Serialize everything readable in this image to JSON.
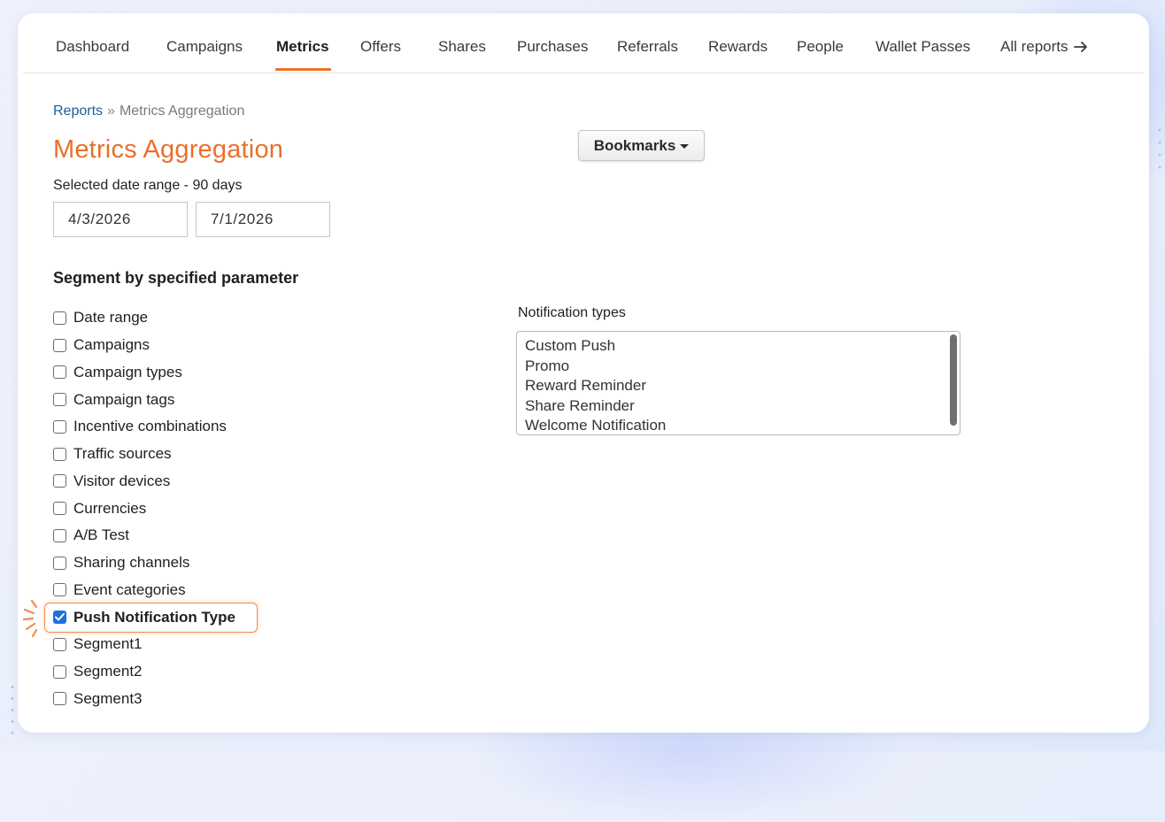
{
  "nav": {
    "items": [
      {
        "label": "Dashboard",
        "active": false
      },
      {
        "label": "Campaigns",
        "active": false
      },
      {
        "label": "Metrics",
        "active": true
      },
      {
        "label": "Offers",
        "active": false
      },
      {
        "label": "Shares",
        "active": false
      },
      {
        "label": "Purchases",
        "active": false
      },
      {
        "label": "Referrals",
        "active": false
      },
      {
        "label": "Rewards",
        "active": false
      },
      {
        "label": "People",
        "active": false
      },
      {
        "label": "Wallet Passes",
        "active": false
      },
      {
        "label": "All reports",
        "active": false,
        "icon": "arrow-right-icon"
      }
    ],
    "accent_color": "#e8702a"
  },
  "breadcrumb": {
    "parent": "Reports",
    "separator": "»",
    "current": "Metrics Aggregation"
  },
  "page": {
    "title": "Metrics Aggregation",
    "bookmarks_label": "Bookmarks",
    "date_caption": "Selected date range - 90 days",
    "start_date": "4/3/2026",
    "end_date": "7/1/2026"
  },
  "segment": {
    "heading": "Segment by specified parameter",
    "options": [
      {
        "label": "Date range",
        "checked": false
      },
      {
        "label": "Campaigns",
        "checked": false
      },
      {
        "label": "Campaign types",
        "checked": false
      },
      {
        "label": "Campaign tags",
        "checked": false
      },
      {
        "label": "Incentive combinations",
        "checked": false
      },
      {
        "label": "Traffic sources",
        "checked": false
      },
      {
        "label": "Visitor devices",
        "checked": false
      },
      {
        "label": "Currencies",
        "checked": false
      },
      {
        "label": "A/B Test",
        "checked": false
      },
      {
        "label": "Sharing channels",
        "checked": false
      },
      {
        "label": "Event categories",
        "checked": false
      },
      {
        "label": "Push Notification Type",
        "checked": true,
        "highlighted": true
      },
      {
        "label": "Segment1",
        "checked": false
      },
      {
        "label": "Segment2",
        "checked": false
      },
      {
        "label": "Segment3",
        "checked": false
      }
    ]
  },
  "notification_types": {
    "label": "Notification types",
    "options": [
      "Custom Push",
      "Promo",
      "Reward Reminder",
      "Share Reminder",
      "Welcome Notification"
    ]
  },
  "colors": {
    "title": "#e8702a",
    "link": "#1f5d99",
    "checkbox_checked": "#1f6fe0",
    "highlight_border": "#f08c4c"
  }
}
